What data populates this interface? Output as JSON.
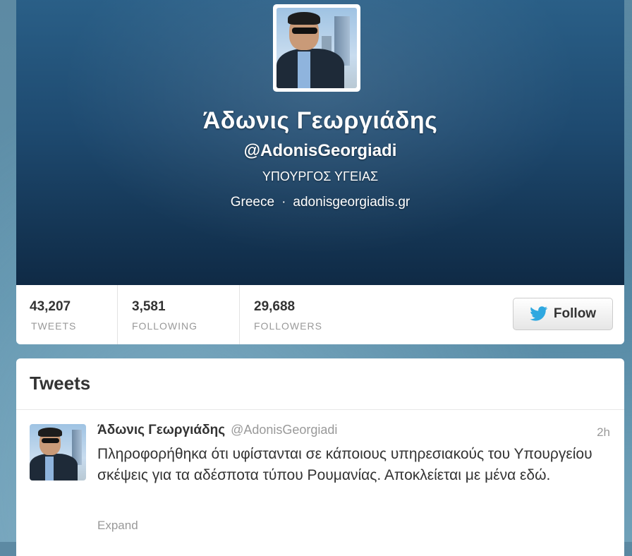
{
  "profile": {
    "display_name": "Άδωνις Γεωργιάδης",
    "screen_name": "@AdonisGeorgiadi",
    "bio": "ΥΠΟΥΡΓΟΣ ΥΓΕΙΑΣ",
    "location": "Greece",
    "separator": "·",
    "website": "adonisgeorgiadis.gr"
  },
  "stats": [
    {
      "value": "43,207",
      "label": "TWEETS"
    },
    {
      "value": "3,581",
      "label": "FOLLOWING"
    },
    {
      "value": "29,688",
      "label": "FOLLOWERS"
    }
  ],
  "follow_button": {
    "label": "Follow",
    "icon": "twitter-bird-icon",
    "icon_color": "#2fa8e0"
  },
  "tweets_section": {
    "title": "Tweets",
    "tweet": {
      "name": "Άδωνις Γεωργιάδης",
      "handle": "@AdonisGeorgiadi",
      "time": "2h",
      "text": "Πληροφορήθηκα ότι υφίστανται σε κάποιους υπηρεσιακούς του Υπουργείου σκέψεις για τα αδέσποτα τύπου Ρουμανίας. Αποκλείεται με μένα εδώ.",
      "expand_label": "Expand"
    }
  }
}
